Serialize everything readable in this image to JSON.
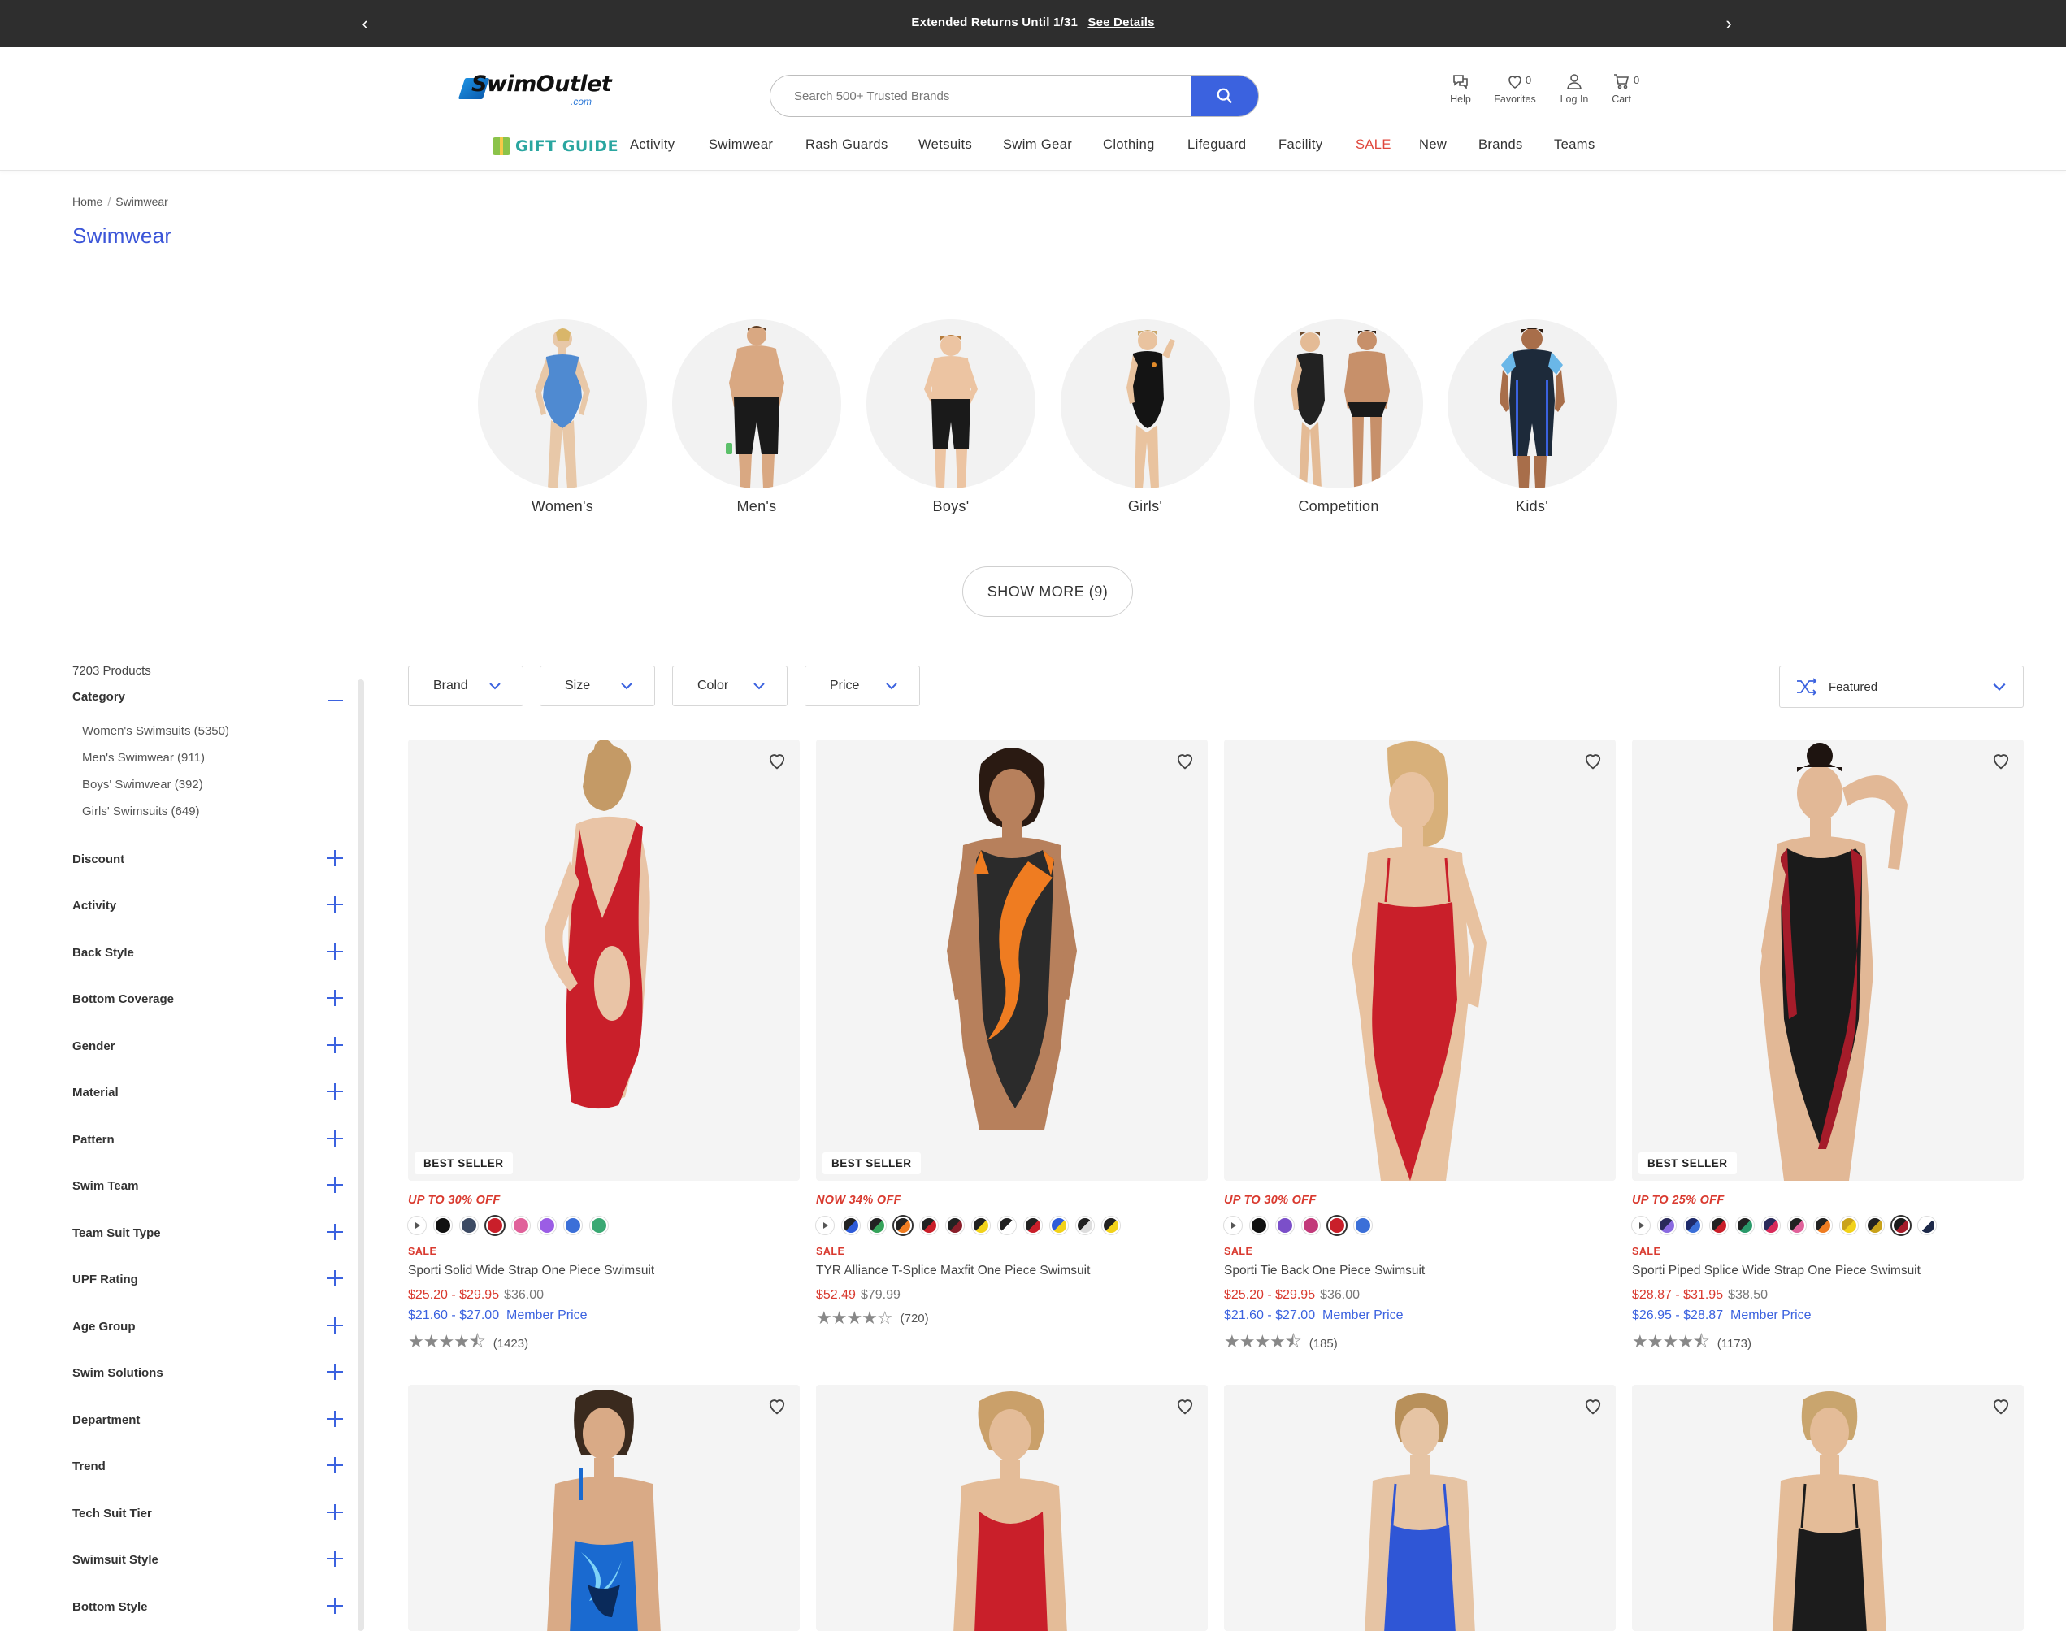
{
  "promo": {
    "message": "Extended Returns Until 1/31",
    "link": "See Details"
  },
  "header": {
    "logo_text": "SwimOutlet",
    "logo_domain": ".com",
    "search_placeholder": "Search 500+ Trusted Brands",
    "help": "Help",
    "favorites": "Favorites",
    "favorites_count": "0",
    "login": "Log In",
    "cart": "Cart",
    "cart_count": "0"
  },
  "nav": {
    "gift": "GIFT GUIDE",
    "items": [
      "Activity",
      "Swimwear",
      "Rash Guards",
      "Wetsuits",
      "Swim Gear",
      "Clothing",
      "Lifeguard",
      "Facility",
      "SALE",
      "New",
      "Brands",
      "Teams"
    ]
  },
  "breadcrumb": {
    "home": "Home",
    "current": "Swimwear"
  },
  "page_title": "Swimwear",
  "categories": [
    "Women's",
    "Men's",
    "Boys'",
    "Girls'",
    "Competition",
    "Kids'"
  ],
  "show_more": "SHOW MORE (9)",
  "sidebar": {
    "count": "7203 Products",
    "category_title": "Category",
    "subcategories": [
      "Women's Swimsuits (5350)",
      "Men's Swimwear  (911)",
      "Boys' Swimwear (392)",
      "Girls' Swimsuits (649)"
    ],
    "facets": [
      "Discount",
      "Activity",
      "Back Style",
      "Bottom Coverage",
      "Gender",
      "Material",
      "Pattern",
      "Swim Team",
      "Team Suit Type",
      "UPF Rating",
      "Age Group",
      "Swim Solutions",
      "Department",
      "Trend",
      "Tech Suit Tier",
      "Swimsuit Style",
      "Bottom Style"
    ]
  },
  "filters": {
    "brand": "Brand",
    "size": "Size",
    "color": "Color",
    "price": "Price",
    "sort": "Featured"
  },
  "products": [
    {
      "badge": "BEST SELLER",
      "discount": "UP TO 30% OFF",
      "sale": "SALE",
      "name": "Sporti Solid Wide Strap One Piece Swimsuit",
      "price": "$25.20 - $29.95",
      "orig": "$36.00",
      "member": "$21.60 - $27.00",
      "member_label": "Member Price",
      "rating": 4.5,
      "reviews": "(1423)"
    },
    {
      "badge": "BEST SELLER",
      "discount": "NOW 34% OFF",
      "sale": "SALE",
      "name": "TYR Alliance T-Splice Maxfit One Piece Swimsuit",
      "price": "$52.49",
      "orig": "$79.99",
      "member": "",
      "member_label": "",
      "rating": 4,
      "reviews": "(720)"
    },
    {
      "badge": "",
      "discount": "UP TO 30% OFF",
      "sale": "SALE",
      "name": "Sporti Tie Back One Piece Swimsuit",
      "price": "$25.20 - $29.95",
      "orig": "$36.00",
      "member": "$21.60 - $27.00",
      "member_label": "Member Price",
      "rating": 4.5,
      "reviews": "(185)"
    },
    {
      "badge": "BEST SELLER",
      "discount": "UP TO 25% OFF",
      "sale": "SALE",
      "name": "Sporti Piped Splice Wide Strap One Piece Swimsuit",
      "price": "$28.87 - $31.95",
      "orig": "$38.50",
      "member": "$26.95 - $28.87",
      "member_label": "Member Price",
      "rating": 4.5,
      "reviews": "(1173)"
    }
  ],
  "colors": {
    "accent": "#3b62df",
    "sale": "#d93a2f",
    "promo_bg": "#2e2e2e"
  }
}
